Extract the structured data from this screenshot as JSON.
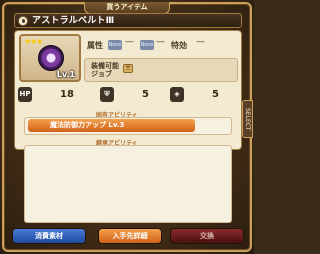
{
  "header": {
    "title": "買うアイテム"
  },
  "item": {
    "name": "アストラルベルトⅢ",
    "level": "Lv.1"
  },
  "attributes": {
    "label_attr": "属性",
    "none1": "None",
    "none2": "None",
    "dash1": "—",
    "dash2": "—",
    "label_special": "特効",
    "dash3": "—"
  },
  "job": {
    "label": "装備可能\nジョブ",
    "badge": "全"
  },
  "stats": {
    "hp_label": "HP",
    "hp": "18",
    "def": "5",
    "res": "5"
  },
  "innate": {
    "title": "固有アビリティ",
    "ability": "魔法防御力アップ Lv.3"
  },
  "inherit": {
    "title": "継承アビリティ"
  },
  "side_tab": "SELECT",
  "buttons": {
    "materials": "消費素材",
    "source": "入手先詳細",
    "exchange": "交換"
  },
  "colors": {
    "accent_orange": "#d0621a",
    "button_blue": "#2a5ab0",
    "button_orange": "#e07820",
    "button_red": "#6a1e1e"
  }
}
